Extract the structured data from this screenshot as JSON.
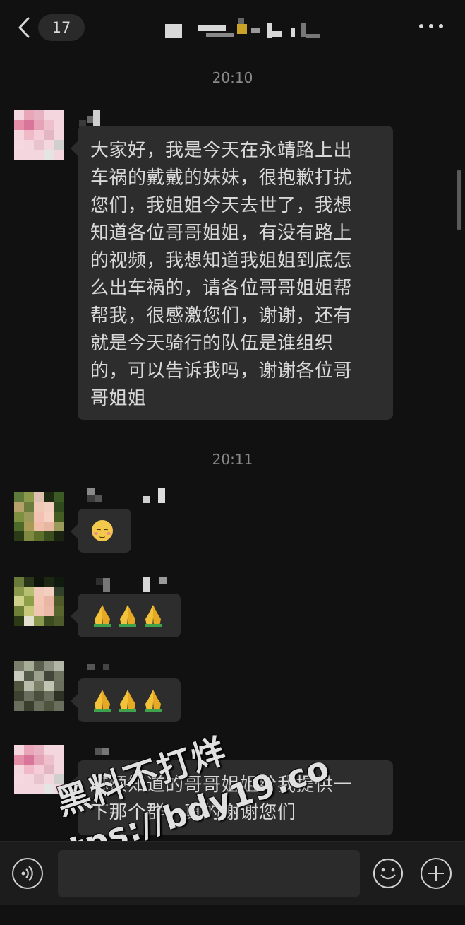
{
  "header": {
    "unread_count": "17"
  },
  "colors": {
    "background": "#111111",
    "bubble": "#2d2d2d",
    "timestamp": "#8a8a8a",
    "text": "#d9d9d9"
  },
  "messages": [
    {
      "time_before": "20:10",
      "sender": "pink-mosaic-avatar",
      "type": "text",
      "text": "大家好，我是今天在永靖路上出\n车祸的戴戴的妹妹，很抱歉打扰\n您们，我姐姐今天去世了，我想\n知道各位哥哥姐姐，有没有路上\n的视频，我想知道我姐姐到底怎\n么出车祸的，请各位哥哥姐姐帮\n帮我，很感激您们，谢谢，还有\n就是今天骑行的队伍是谁组织\n的，可以告诉我吗，谢谢各位哥\n哥姐姐"
    },
    {
      "time_before": "20:11",
      "sender": "green-mosaic-avatar",
      "type": "emoji",
      "emoji": "smiling-face-icon"
    },
    {
      "sender": "dark-mosaic-avatar",
      "type": "emoji",
      "emoji": "pray-hands-icon x3"
    },
    {
      "sender": "grey-mosaic-avatar",
      "type": "emoji",
      "emoji": "pray-hands-icon x3"
    },
    {
      "sender": "pink-mosaic-avatar",
      "type": "text",
      "text": "麻烦知道的哥哥姐姐给我提供一\n下那个群，真的谢谢您们"
    }
  ],
  "watermark": {
    "line1": "黑料不打烊",
    "line2": "https://bdy19.co"
  },
  "bottom_bar": {
    "input_placeholder": ""
  }
}
